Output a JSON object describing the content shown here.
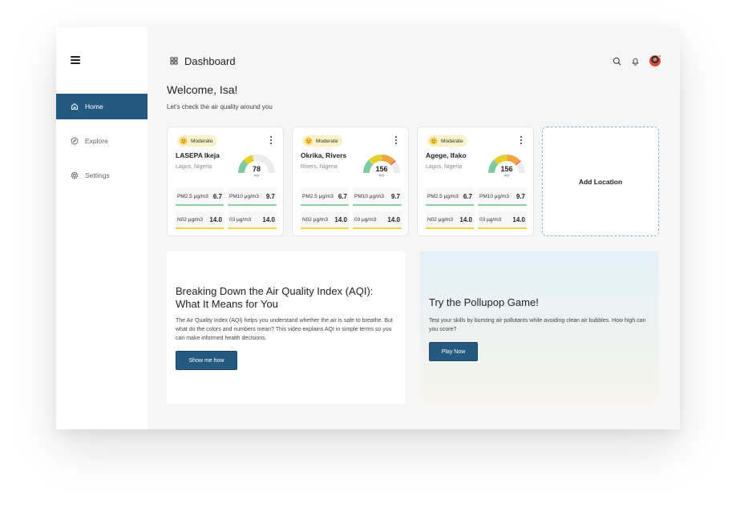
{
  "app": {
    "page_title": "Dashboard"
  },
  "sidebar": {
    "items": [
      {
        "label": "Home",
        "icon": "home-icon",
        "active": true
      },
      {
        "label": "Explore",
        "icon": "compass-icon",
        "active": false
      },
      {
        "label": "Settings",
        "icon": "gear-icon",
        "active": false
      }
    ]
  },
  "header": {
    "welcome": "Welcome, Isa!",
    "subtitle": "Let's check the air quality around you"
  },
  "locations": [
    {
      "status": "Moderate",
      "name": "LASEPA Ikeja",
      "region": "Lagos, Nigeria",
      "aqi": "78",
      "aqi_label": "AQI",
      "gauge_level": 0.43,
      "metrics": [
        {
          "label": "PM2.5",
          "unit": "μg/m3",
          "value": "6.7"
        },
        {
          "label": "PM10",
          "unit": "μg/m3",
          "value": "9.7"
        },
        {
          "label": "N02",
          "unit": "μg/m3",
          "value": "14.0"
        },
        {
          "label": "03",
          "unit": "μg/m3",
          "value": "14.0"
        }
      ]
    },
    {
      "status": "Moderate",
      "name": "Okrika, Rivers",
      "region": "Rivers, Nigeria",
      "aqi": "156",
      "aqi_label": "AQI",
      "gauge_level": 0.78,
      "metrics": [
        {
          "label": "PM2.5",
          "unit": "μg/m3",
          "value": "6.7"
        },
        {
          "label": "PM10",
          "unit": "μg/m3",
          "value": "9.7"
        },
        {
          "label": "N02",
          "unit": "μg/m3",
          "value": "14.0"
        },
        {
          "label": "03",
          "unit": "μg/m3",
          "value": "14.0"
        }
      ]
    },
    {
      "status": "Moderate",
      "name": "Agege, Ifako",
      "region": "Lagos, Nigeria",
      "aqi": "156",
      "aqi_label": "AQI",
      "gauge_level": 0.78,
      "metrics": [
        {
          "label": "PM2.5",
          "unit": "μg/m3",
          "value": "6.7"
        },
        {
          "label": "PM10",
          "unit": "μg/m3",
          "value": "9.7"
        },
        {
          "label": "N02",
          "unit": "μg/m3",
          "value": "14.0"
        },
        {
          "label": "03",
          "unit": "μg/m3",
          "value": "14.0"
        }
      ]
    }
  ],
  "add_location_label": "Add Location",
  "aqi_panel": {
    "title": "Breaking Down the Air Quality Index (AQI): What It Means for You",
    "body": "The Air Quality Index (AQI) helps you understand whether the air is safe to breathe. But what do the colors and numbers mean? This video explains AQI in simple terms so you can make informed health decisions.",
    "button": "Show me how"
  },
  "game_panel": {
    "title": "Try the Pollupop Game!",
    "body": "Test your skills by bursting air pollutants while avoiding clean air bubbles. How high can you score?",
    "button": "Play Now"
  },
  "colors": {
    "primary": "#245a80",
    "badge_bg": "#fdf1c9",
    "gauge_green": "#7fc9a0",
    "gauge_yellow": "#e6cf2a",
    "gauge_orange": "#f0a640",
    "gauge_red": "#e55a3c",
    "gauge_track": "#ececec"
  }
}
